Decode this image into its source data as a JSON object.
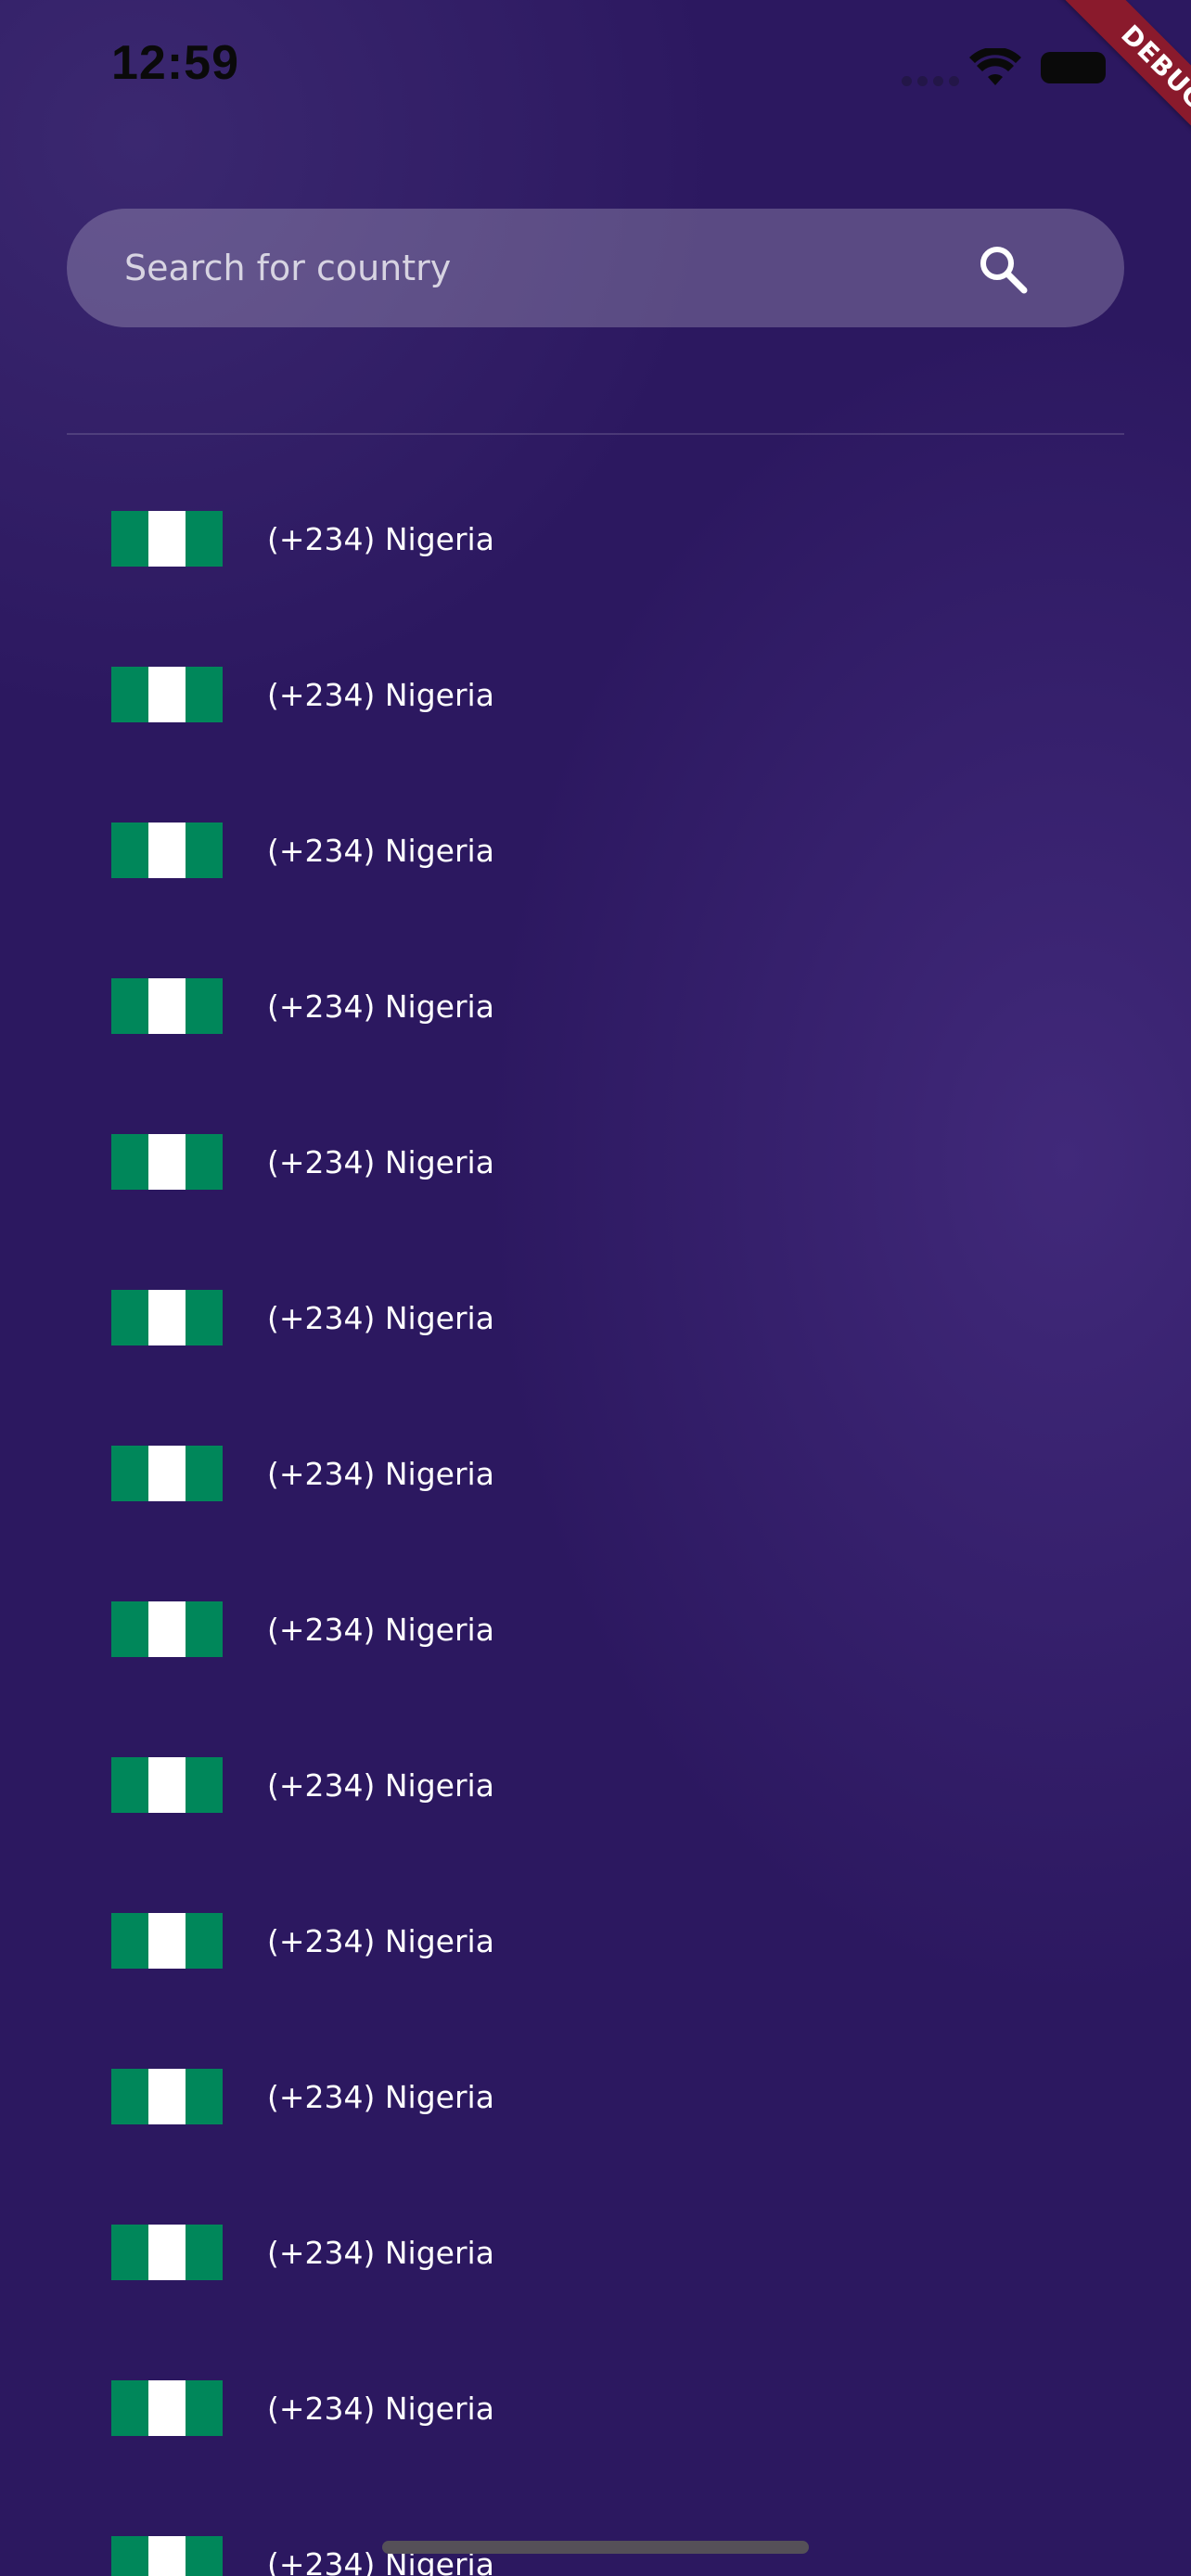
{
  "status_bar": {
    "time": "12:59"
  },
  "debug_banner": {
    "label": "DEBUG",
    "color": "#8a1a2c"
  },
  "search": {
    "placeholder": "Search for country",
    "value": "",
    "icon": "search-icon"
  },
  "countries": [
    {
      "code": "(+234)",
      "name": "Nigeria",
      "label": "(+234) Nigeria",
      "flag": "nigeria-flag-icon"
    },
    {
      "code": "(+234)",
      "name": "Nigeria",
      "label": "(+234) Nigeria",
      "flag": "nigeria-flag-icon"
    },
    {
      "code": "(+234)",
      "name": "Nigeria",
      "label": "(+234) Nigeria",
      "flag": "nigeria-flag-icon"
    },
    {
      "code": "(+234)",
      "name": "Nigeria",
      "label": "(+234) Nigeria",
      "flag": "nigeria-flag-icon"
    },
    {
      "code": "(+234)",
      "name": "Nigeria",
      "label": "(+234) Nigeria",
      "flag": "nigeria-flag-icon"
    },
    {
      "code": "(+234)",
      "name": "Nigeria",
      "label": "(+234) Nigeria",
      "flag": "nigeria-flag-icon"
    },
    {
      "code": "(+234)",
      "name": "Nigeria",
      "label": "(+234) Nigeria",
      "flag": "nigeria-flag-icon"
    },
    {
      "code": "(+234)",
      "name": "Nigeria",
      "label": "(+234) Nigeria",
      "flag": "nigeria-flag-icon"
    },
    {
      "code": "(+234)",
      "name": "Nigeria",
      "label": "(+234) Nigeria",
      "flag": "nigeria-flag-icon"
    },
    {
      "code": "(+234)",
      "name": "Nigeria",
      "label": "(+234) Nigeria",
      "flag": "nigeria-flag-icon"
    },
    {
      "code": "(+234)",
      "name": "Nigeria",
      "label": "(+234) Nigeria",
      "flag": "nigeria-flag-icon"
    },
    {
      "code": "(+234)",
      "name": "Nigeria",
      "label": "(+234) Nigeria",
      "flag": "nigeria-flag-icon"
    },
    {
      "code": "(+234)",
      "name": "Nigeria",
      "label": "(+234) Nigeria",
      "flag": "nigeria-flag-icon"
    },
    {
      "code": "(+234)",
      "name": "Nigeria",
      "label": "(+234) Nigeria",
      "flag": "nigeria-flag-icon"
    }
  ],
  "colors": {
    "background": "#2c1860",
    "flag_green": "#00875a",
    "flag_white": "#ffffff",
    "text": "#ffffff"
  }
}
